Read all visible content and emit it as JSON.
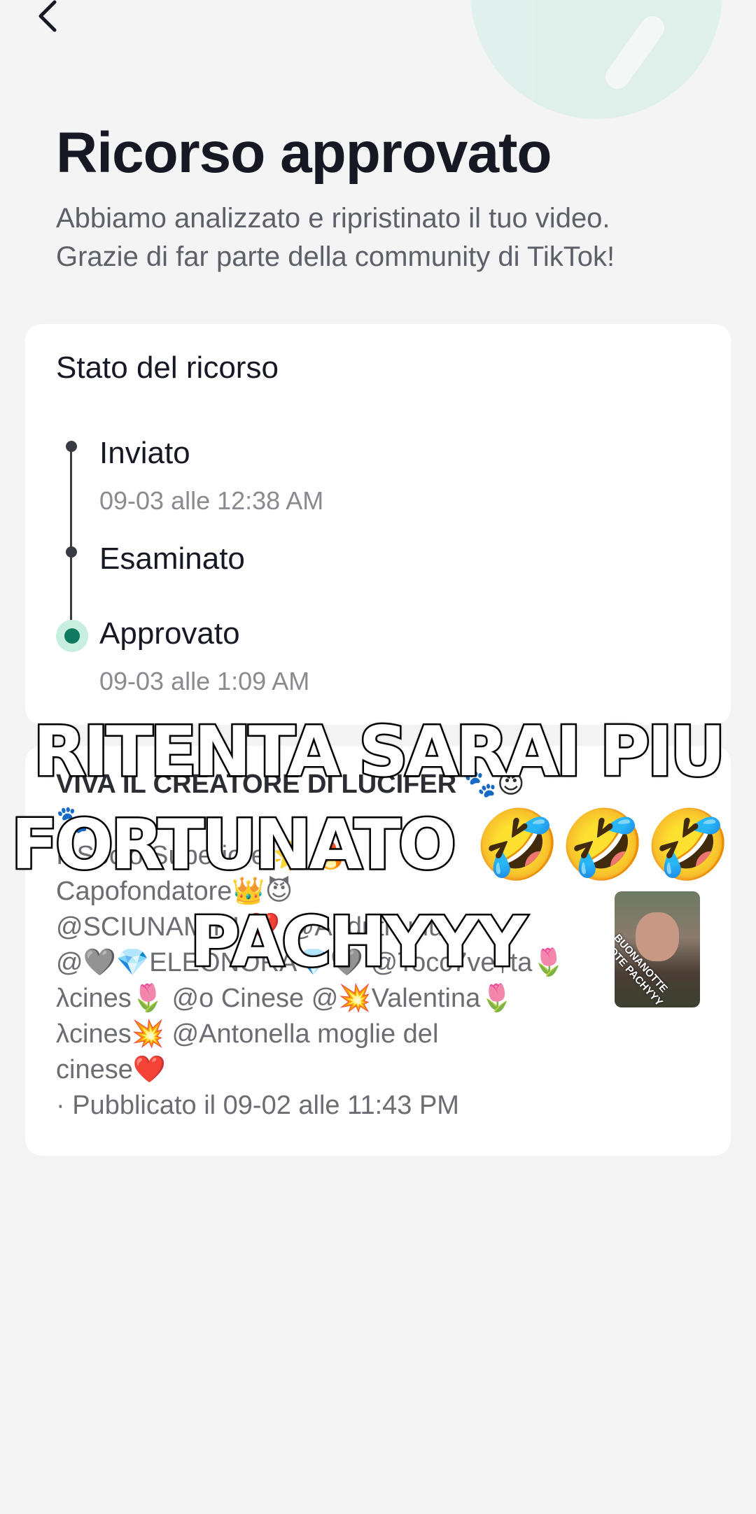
{
  "header": {
    "back_icon": "chevron-left-icon",
    "title": "Ricorso approvato",
    "subtitle_line1": "Abbiamo analizzato e ripristinato il tuo video.",
    "subtitle_line2": "Grazie di far parte della community di TikTok!"
  },
  "status_card": {
    "title": "Stato del ricorso",
    "steps": [
      {
        "label": "Inviato",
        "date": "09-03 alle 12:38 AM"
      },
      {
        "label": "Esaminato",
        "date": ""
      },
      {
        "label": "Approvato",
        "date": "09-03 alle 1:09 AM"
      }
    ],
    "accent_color": "#117a5e"
  },
  "video_card": {
    "lines": [
      "VIVA IL CREATORE DI LUCIFER 🐾😈",
      "🐾",
      "Il Socio Superiore 🌟 🔥",
      "Capofondatore👑😈",
      "@SCIUNAMIRI ❤️ @Auduthudu",
      "@🩶💎ELEONORA💎🩶 @Tocc7ve†ta🌷",
      "λcines🌷 @o Cinese @💥Valentina🌷",
      "λcines💥 @Antonella moglie del",
      "cinese❤️",
      "· Pubblicato il 09-02 alle 11:43 PM"
    ],
    "thumbnail_text": "BUONANOTTE LOTE PACHYYY"
  },
  "overlay_caption": {
    "line1": "RITENTA SARAI PIU",
    "line2_text": "FORTUNATO",
    "line2_emojis": "🤣🤣🤣",
    "line3": "PACHYYY"
  }
}
